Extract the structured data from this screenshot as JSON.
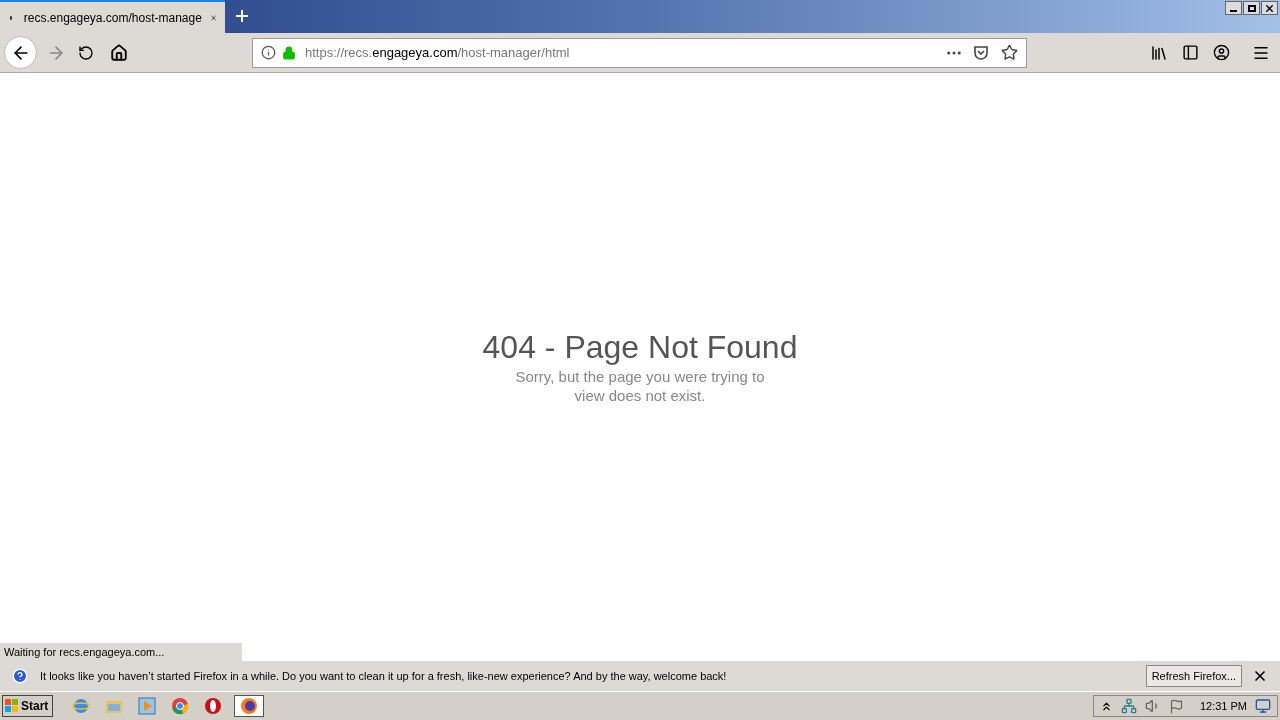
{
  "tabs": [
    {
      "title": "recs.engageya.com/host-manage",
      "selected": true
    }
  ],
  "address_bar": {
    "prefix": "https://recs.",
    "domain": "engageya.com",
    "path": "/host-manager/html"
  },
  "page": {
    "heading": "404 - Page Not Found",
    "message": "Sorry, but the page you were trying to view does not exist."
  },
  "status_text": "Waiting for recs.engageya.com...",
  "notification": {
    "message": "It looks like you haven’t started Firefox in a while. Do you want to clean it up for a fresh, like-new experience? And by the way, welcome back!",
    "button": "Refresh Firefox..."
  },
  "taskbar": {
    "start": "Start",
    "apps": [
      {
        "kind": "ie",
        "selected": false
      },
      {
        "kind": "explorer",
        "selected": false
      },
      {
        "kind": "media",
        "selected": false
      },
      {
        "kind": "chrome",
        "selected": false
      },
      {
        "kind": "opera",
        "selected": false
      },
      {
        "kind": "firefox",
        "selected": true
      }
    ],
    "clock": "12:31 PM"
  }
}
